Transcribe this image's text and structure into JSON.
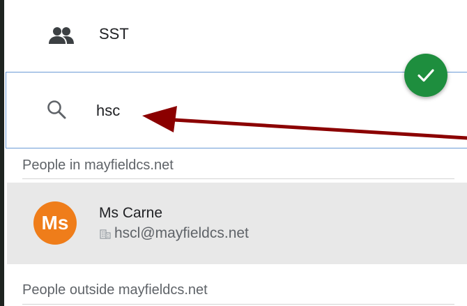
{
  "group": {
    "label": "SST",
    "icon": "people-group-icon"
  },
  "search": {
    "value": "hsc",
    "icon": "search-icon",
    "border_color": "#6b9bd6"
  },
  "confirm": {
    "icon": "checkmark-icon",
    "color": "#1e8e3e"
  },
  "sections": {
    "inside_header": "People in mayfieldcs.net",
    "outside_header": "People outside mayfieldcs.net"
  },
  "results": [
    {
      "avatar_initials": "Ms",
      "avatar_color": "#ef7d1a",
      "name": "Ms Carne",
      "email": "hscl@mayfieldcs.net",
      "org_icon": "building-icon"
    }
  ],
  "annotation": {
    "arrow_color": "#8b0000",
    "icon": "annotation-arrow"
  }
}
